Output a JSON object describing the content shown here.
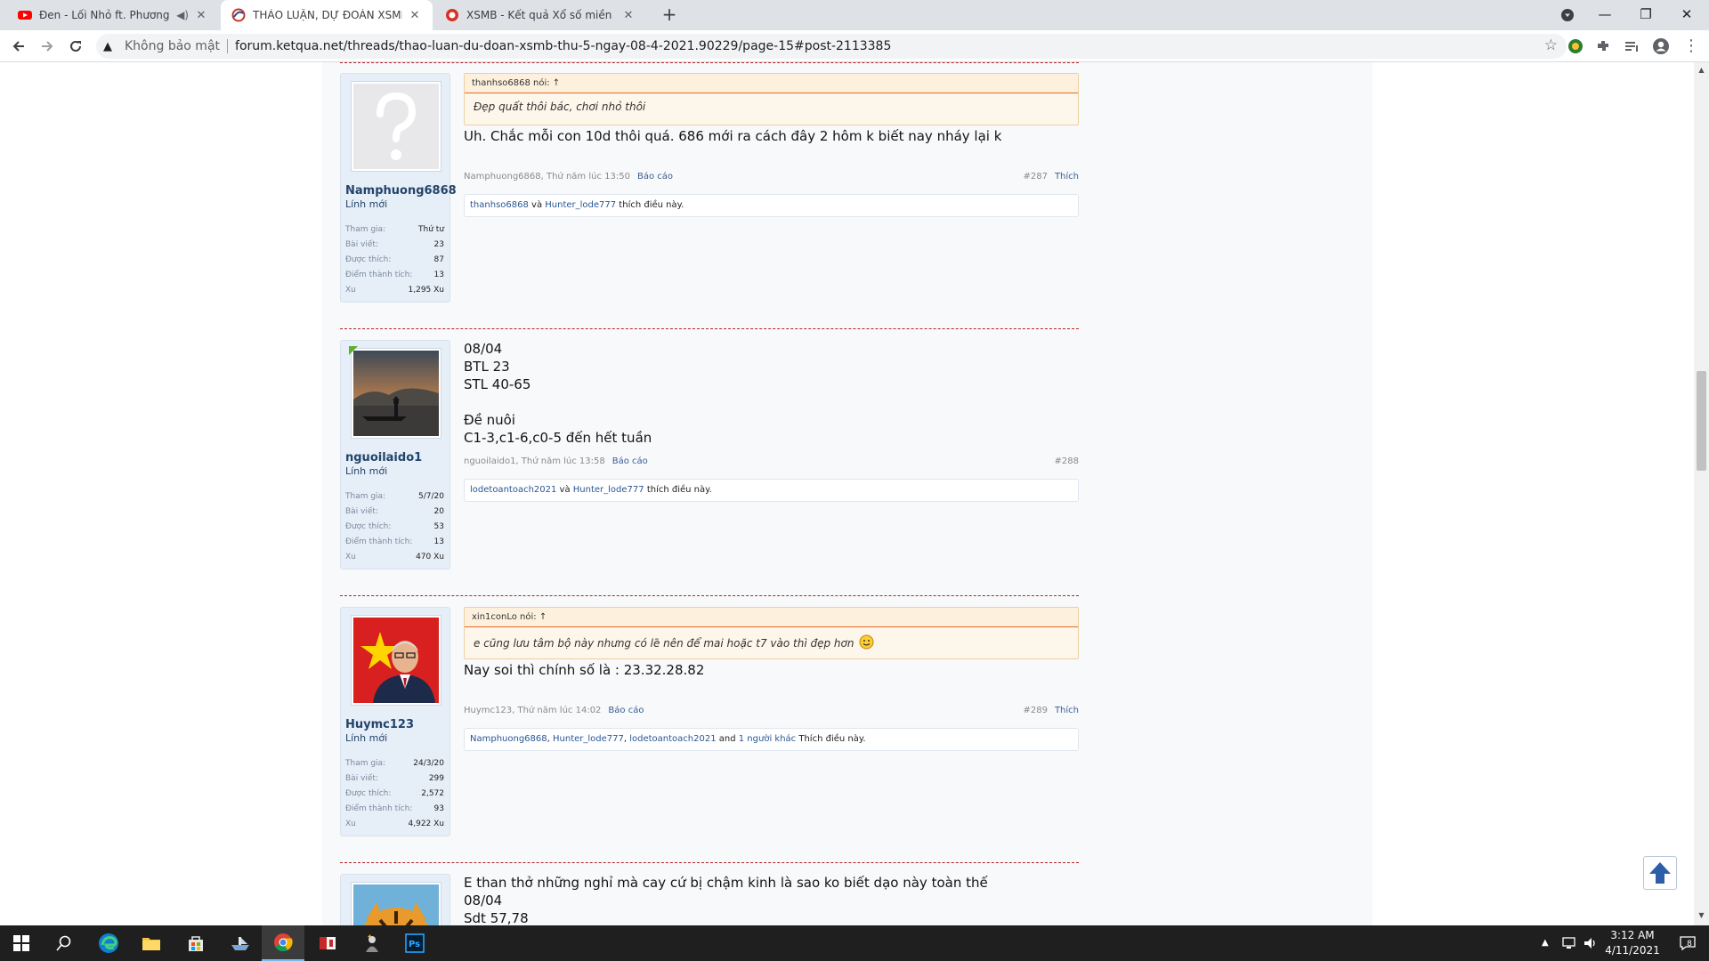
{
  "browser": {
    "tabs": [
      {
        "title": "Đen - Lối Nhỏ ft. Phương Anh",
        "favicon": "youtube-icon",
        "audio": true,
        "active": false
      },
      {
        "title": "THẢO LUẬN, DỰ ĐOÁN XSMB TH",
        "favicon": "ketqua-icon",
        "active": true
      },
      {
        "title": "XSMB - Kết quả Xổ số miền Bắc",
        "favicon": "xsmb-icon",
        "active": false
      }
    ],
    "security_label": "Không bảo mật",
    "url": "forum.ketqua.net/threads/thao-luan-du-doan-xsmb-thu-5-ngay-08-4-2021.90229/page-15#post-2113385"
  },
  "posts": [
    {
      "user": {
        "name": "Namphuong6868",
        "title": "Lính mới",
        "avatar": "default-avatar-icon",
        "stats": [
          {
            "label": "Tham gia:",
            "value": "Thứ tư"
          },
          {
            "label": "Bài viết:",
            "value": "23"
          },
          {
            "label": "Được thích:",
            "value": "87"
          },
          {
            "label": "Điểm thành tích:",
            "value": "13"
          },
          {
            "label": "Xu",
            "value": "1,295 Xu"
          }
        ]
      },
      "quote": {
        "author": "thanhso6868 nói: ↑",
        "text": "Đẹp quất thôi bác, chơi nhỏ thôi"
      },
      "lines": [
        "Uh. Chắc mỗi con 10d thôi quá. 686 mới ra cách đây 2 hôm k biết nay nháy lại k"
      ],
      "meta": {
        "author_time": "Namphuong6868, Thứ năm lúc 13:50",
        "report": "Báo cáo",
        "number": "#287",
        "like": "Thích"
      },
      "likes": {
        "users": [
          "thanhso6868",
          "Hunter_lode777"
        ],
        "connector": " và ",
        "suffix": " thích điều này."
      }
    },
    {
      "user": {
        "name": "nguoilaido1",
        "title": "Lính mới",
        "avatar": "boatman-avatar",
        "stats": [
          {
            "label": "Tham gia:",
            "value": "5/7/20"
          },
          {
            "label": "Bài viết:",
            "value": "20"
          },
          {
            "label": "Được thích:",
            "value": "53"
          },
          {
            "label": "Điểm thành tích:",
            "value": "13"
          },
          {
            "label": "Xu",
            "value": "470 Xu"
          }
        ]
      },
      "lines": [
        "08/04",
        "BTL 23",
        "STL 40-65",
        "",
        "Đề nuôi",
        "C1-3,c1-6,c0-5 đến hết tuần"
      ],
      "meta": {
        "author_time": "nguoilaido1, Thứ năm lúc 13:58",
        "report": "Báo cáo",
        "number": "#288",
        "like": ""
      },
      "likes": {
        "users": [
          "lodetoantoach2021",
          "Hunter_lode777"
        ],
        "connector": " và ",
        "suffix": " thích điều này."
      }
    },
    {
      "user": {
        "name": "Huymc123",
        "title": "Lính mới",
        "avatar": "flag-man-avatar",
        "stats": [
          {
            "label": "Tham gia:",
            "value": "24/3/20"
          },
          {
            "label": "Bài viết:",
            "value": "299"
          },
          {
            "label": "Được thích:",
            "value": "2,572"
          },
          {
            "label": "Điểm thành tích:",
            "value": "93"
          },
          {
            "label": "Xu",
            "value": "4,922 Xu"
          }
        ]
      },
      "quote": {
        "author": "xin1conLo nói: ↑",
        "text": "e cũng lưu tâm bộ này nhưng có lẽ nên để mai hoặc t7 vào thì đẹp hơn"
      },
      "lines": [
        "Nay soi thì chính số là : 23.32.28.82"
      ],
      "meta": {
        "author_time": "Huymc123, Thứ năm lúc 14:02",
        "report": "Báo cáo",
        "number": "#289",
        "like": "Thích"
      },
      "likes": {
        "users": [
          "Namphuong6868",
          "Hunter_lode777",
          "lodetoantoach2021",
          "1 người khác"
        ],
        "connector": ", ",
        "and_word": " and ",
        "suffix": " Thích điều này."
      }
    },
    {
      "user": {
        "name": "",
        "avatar": "tiger-avatar"
      },
      "lines": [
        "E than thở những nghỉ mà cay cứ bị chậm kinh là sao ko biết dạo này toàn thế",
        "08/04",
        "Sdt 57,78"
      ]
    }
  ],
  "taskbar": {
    "time": "3:12 AM",
    "date": "4/11/2021",
    "notification_count": "8"
  }
}
